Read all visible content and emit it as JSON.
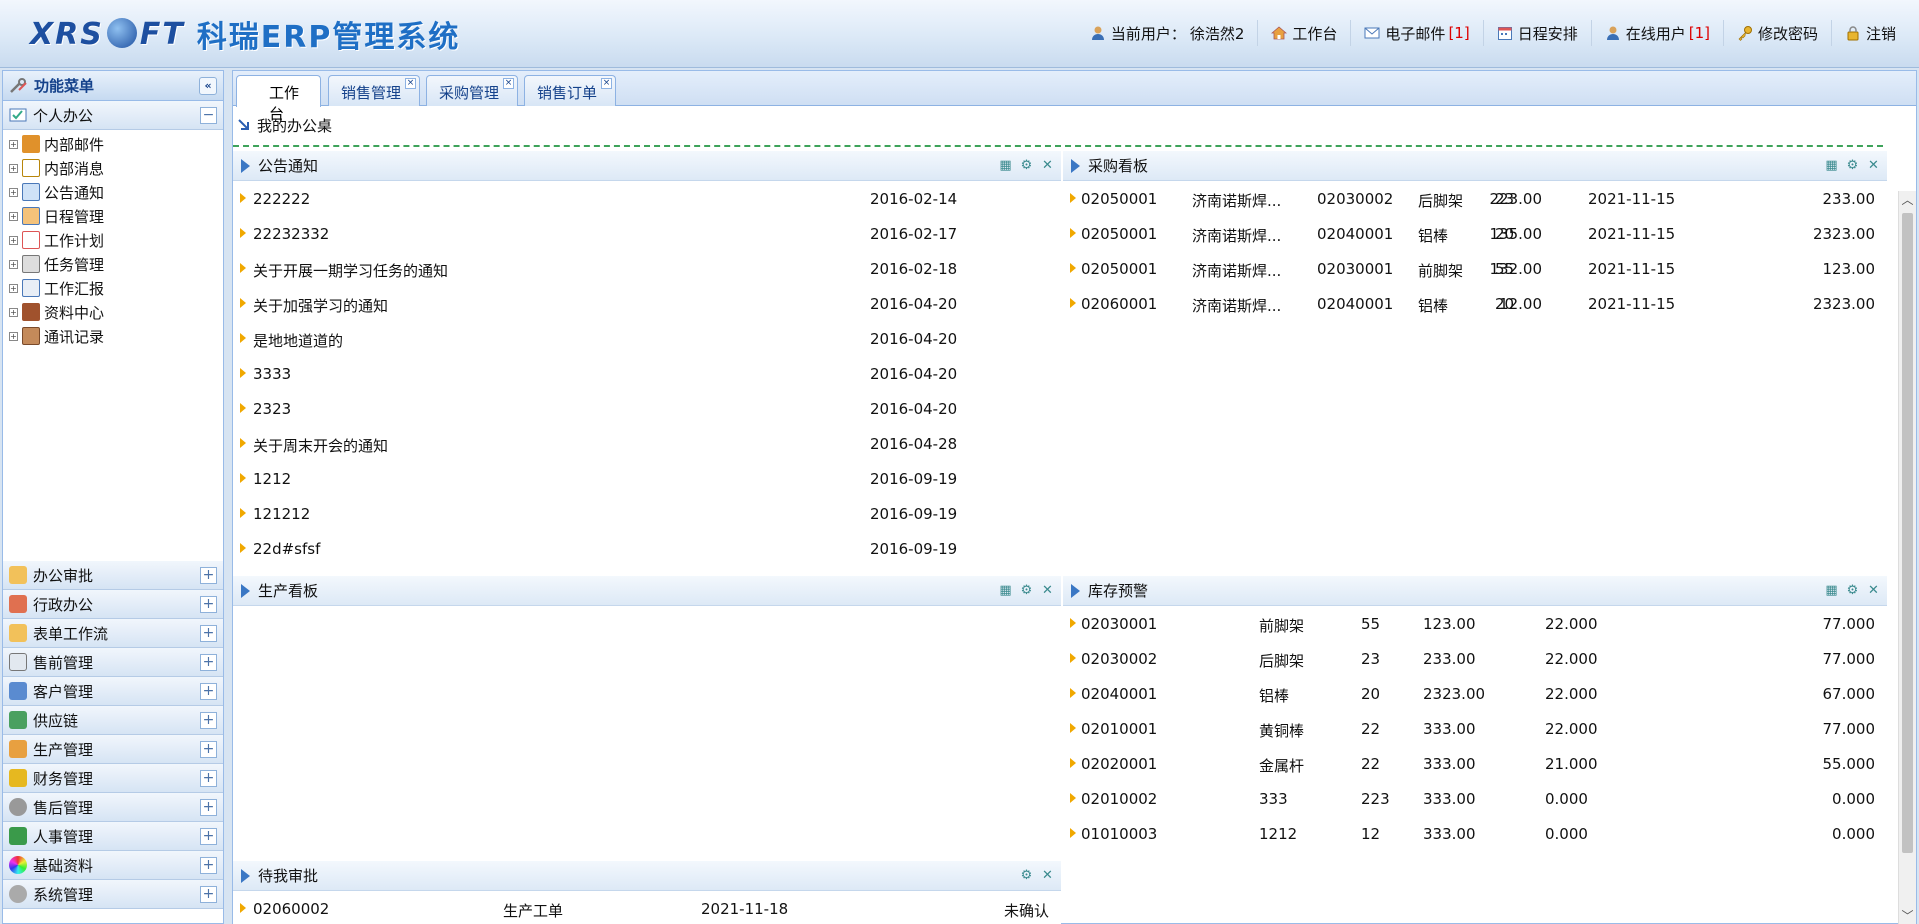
{
  "header": {
    "logo_text": "XRS  FT",
    "system_name": "科瑞ERP管理系统",
    "current_user_label": "当前用户：",
    "current_user_name": "徐浩然2",
    "workbench": "工作台",
    "email_label": "电子邮件",
    "email_count": "[1]",
    "schedule": "日程安排",
    "online_label": "在线用户",
    "online_count": "[1]",
    "change_password": "修改密码",
    "logout": "注销"
  },
  "sidebar": {
    "title": "功能菜单",
    "current_section": "个人办公",
    "tree_items": [
      "内部邮件",
      "内部消息",
      "公告通知",
      "日程管理",
      "工作计划",
      "任务管理",
      "工作汇报",
      "资料中心",
      "通讯记录"
    ],
    "sections": [
      "办公审批",
      "行政办公",
      "表单工作流",
      "售前管理",
      "客户管理",
      "供应链",
      "生产管理",
      "财务管理",
      "售后管理",
      "人事管理",
      "基础资料",
      "系统管理"
    ]
  },
  "tabs": [
    {
      "label": "工作台",
      "active": true
    },
    {
      "label": "销售管理"
    },
    {
      "label": "采购管理"
    },
    {
      "label": "销售订单"
    }
  ],
  "desk_title": "我的办公桌",
  "announcements": {
    "title": "公告通知",
    "rows": [
      {
        "title": "222222",
        "date": "2016-02-14"
      },
      {
        "title": "22232332",
        "date": "2016-02-17"
      },
      {
        "title": "关于开展一期学习任务的通知",
        "date": "2016-02-18"
      },
      {
        "title": "关于加强学习的通知",
        "date": "2016-04-20"
      },
      {
        "title": "是地地道道的",
        "date": "2016-04-20"
      },
      {
        "title": "3333",
        "date": "2016-04-20"
      },
      {
        "title": "2323",
        "date": "2016-04-20"
      },
      {
        "title": "关于周末开会的通知",
        "date": "2016-04-28"
      },
      {
        "title": "1212",
        "date": "2016-09-19"
      },
      {
        "title": "121212",
        "date": "2016-09-19"
      },
      {
        "title": "22d#sfsf",
        "date": "2016-09-19"
      }
    ]
  },
  "purchase": {
    "title": "采购看板",
    "rows": [
      {
        "order": "02050001",
        "supplier": "济南诺斯焊...",
        "code": "02030002",
        "name": "后脚架",
        "qty": "23",
        "price": "223.00",
        "date": "2021-11-15",
        "amount": "233.00"
      },
      {
        "order": "02050001",
        "supplier": "济南诺斯焊...",
        "code": "02040001",
        "name": "铝棒",
        "qty": "20",
        "price": "135.00",
        "date": "2021-11-15",
        "amount": "2323.00"
      },
      {
        "order": "02050001",
        "supplier": "济南诺斯焊...",
        "code": "02030001",
        "name": "前脚架",
        "qty": "55",
        "price": "132.00",
        "date": "2021-11-15",
        "amount": "123.00"
      },
      {
        "order": "02060001",
        "supplier": "济南诺斯焊...",
        "code": "02040001",
        "name": "铝棒",
        "qty": "20",
        "price": "12.00",
        "date": "2021-11-15",
        "amount": "2323.00"
      }
    ]
  },
  "production": {
    "title": "生产看板"
  },
  "inventory": {
    "title": "库存预警",
    "rows": [
      {
        "code": "02030001",
        "name": "前脚架",
        "qty": "55",
        "price": "123.00",
        "min": "22.000",
        "max": "77.000"
      },
      {
        "code": "02030002",
        "name": "后脚架",
        "qty": "23",
        "price": "233.00",
        "min": "22.000",
        "max": "77.000"
      },
      {
        "code": "02040001",
        "name": "铝棒",
        "qty": "20",
        "price": "2323.00",
        "min": "22.000",
        "max": "67.000"
      },
      {
        "code": "02010001",
        "name": "黄铜棒",
        "qty": "22",
        "price": "333.00",
        "min": "22.000",
        "max": "77.000"
      },
      {
        "code": "02020001",
        "name": "金属杆",
        "qty": "22",
        "price": "333.00",
        "min": "21.000",
        "max": "55.000"
      },
      {
        "code": "02010002",
        "name": "333",
        "qty": "223",
        "price": "333.00",
        "min": "0.000",
        "max": "0.000"
      },
      {
        "code": "01010003",
        "name": "1212",
        "qty": "12",
        "price": "333.00",
        "min": "0.000",
        "max": "0.000"
      }
    ]
  },
  "approval": {
    "title": "待我审批",
    "rows": [
      {
        "code": "02060002",
        "type": "生产工单",
        "date": "2021-11-18",
        "status": "未确认"
      }
    ]
  },
  "colors": {
    "accent": "#15428b",
    "bullet": "#f0a800",
    "dashed_line": "#3ea35a"
  }
}
